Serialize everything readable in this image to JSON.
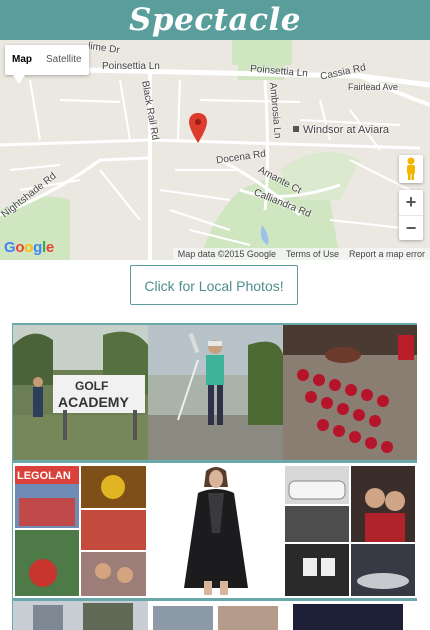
{
  "app": {
    "title": "Spectacle"
  },
  "map": {
    "type_control": {
      "map_label": "Map",
      "satellite_label": "Satellite"
    },
    "road_labels": [
      "Poinsettia Ln",
      "Poinsettia Ln",
      "Cassia Rd",
      "Fairlead Ave",
      "Black Rail Rd",
      "Ambrosia Ln",
      "Docena Rd",
      "Amante Ct",
      "Calliandra Rd",
      "Nightshade Rd",
      "lime Dr"
    ],
    "place_label": "Windsor at Aviara",
    "google_logo": "Google",
    "footer": {
      "data": "Map data ©2015 Google",
      "terms": "Terms of Use",
      "report": "Report a map error"
    },
    "zoom_in": "+",
    "zoom_out": "−"
  },
  "local_photos_button": "Click for Local Photos!",
  "photos": {
    "golf_sign_line1": "GOLF",
    "golf_sign_line2": "ACADEMY",
    "legoland": "LEGOLAN"
  },
  "colors": {
    "header": "#5a9e9c",
    "gallery_bg": "#6aa9ab",
    "button_text": "#4f8e8c",
    "map_pin": "#dd3b2c"
  }
}
